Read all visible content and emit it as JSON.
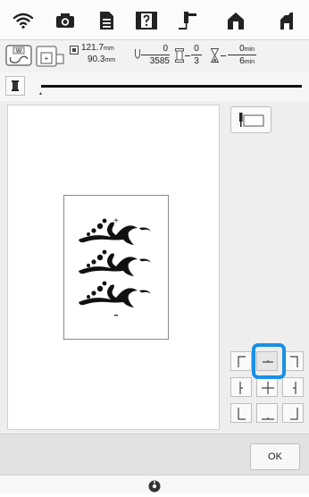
{
  "top_bar": {
    "icons": [
      "wifi-icon",
      "camera-icon",
      "document-icon",
      "help-icon",
      "needle-icon",
      "home-icon",
      "machine-icon"
    ]
  },
  "info_bar": {
    "size_width": "121.7",
    "size_height": "90.3",
    "size_unit": "mm",
    "stitch_current": "0",
    "stitch_total": "3585",
    "color_current": "0",
    "color_total": "3",
    "time_current": "0",
    "time_total": "6",
    "time_unit": "min"
  },
  "alignment_grid": {
    "selected": "top-center"
  },
  "buttons": {
    "ok_label": "OK"
  },
  "colors": {
    "selection_ring": "#1a8fe3"
  }
}
